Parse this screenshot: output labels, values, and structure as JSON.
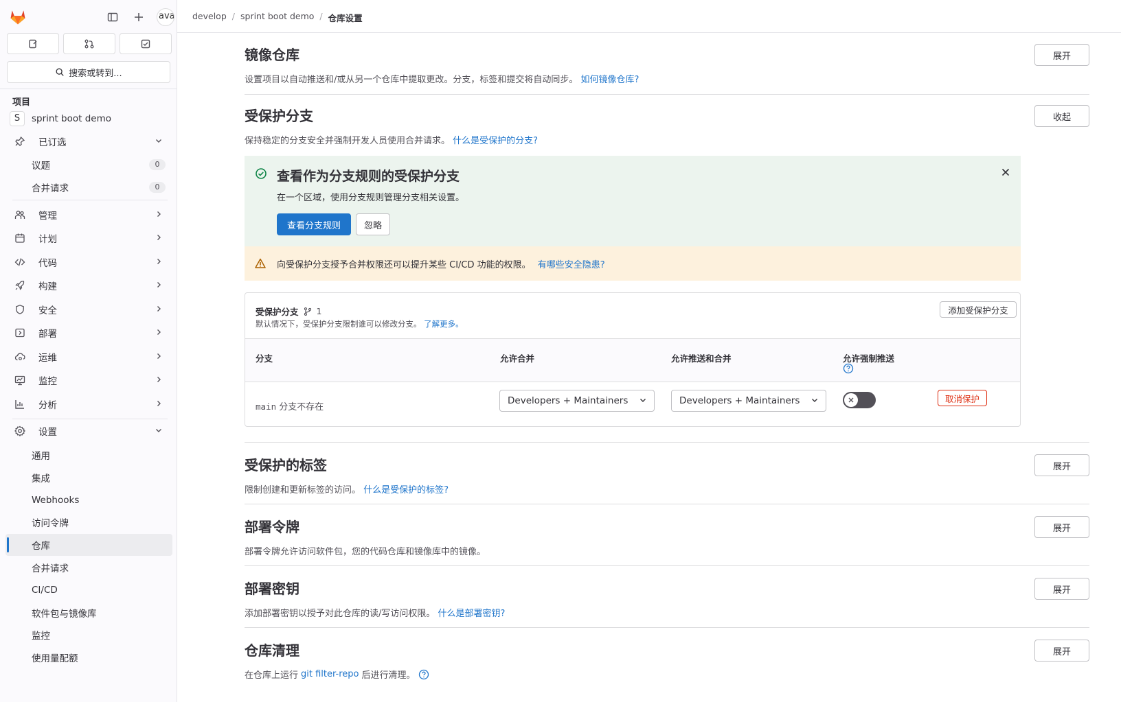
{
  "header": {
    "breadcrumb": [
      "develop",
      "sprint boot demo",
      "仓库设置"
    ],
    "avatar_text": "ava"
  },
  "sidebar": {
    "search_label": "搜索或转到...",
    "section_title": "项目",
    "project_name": "sprint boot demo",
    "project_initial": "S",
    "pinned_label": "已订选",
    "pinned_items": [
      {
        "label": "议题",
        "count": "0"
      },
      {
        "label": "合并请求",
        "count": "0"
      }
    ],
    "nav_items": [
      {
        "label": "管理",
        "icon": "users-icon"
      },
      {
        "label": "计划",
        "icon": "calendar-icon"
      },
      {
        "label": "代码",
        "icon": "code-icon"
      },
      {
        "label": "构建",
        "icon": "rocket-icon"
      },
      {
        "label": "安全",
        "icon": "shield-icon"
      },
      {
        "label": "部署",
        "icon": "deploy-icon"
      },
      {
        "label": "运维",
        "icon": "cloud-gear-icon"
      },
      {
        "label": "监控",
        "icon": "monitor-icon"
      },
      {
        "label": "分析",
        "icon": "chart-icon"
      }
    ],
    "settings_label": "设置",
    "settings_items": [
      "通用",
      "集成",
      "Webhooks",
      "访问令牌",
      "仓库",
      "合并请求",
      "CI/CD",
      "软件包与镜像库",
      "监控",
      "使用量配额"
    ],
    "active_settings_item": "仓库"
  },
  "main": {
    "mirror": {
      "title": "镜像仓库",
      "desc": "设置项目以自动推送和/或从另一个仓库中提取更改。分支，标签和提交将自动同步。",
      "link": "如何镜像仓库?",
      "button": "展开"
    },
    "protected_branches": {
      "title": "受保护分支",
      "desc": "保持稳定的分支安全并强制开发人员使用合并请求。",
      "link": "什么是受保护的分支?",
      "button": "收起",
      "alert": {
        "title": "查看作为分支规则的受保护分支",
        "body": "在一个区域，使用分支规则管理分支相关设置。",
        "primary_button": "查看分支规则",
        "dismiss_button": "忽略"
      },
      "warning": {
        "text": "向受保护分支授予合并权限还可以提升某些 CI/CD 功能的权限。",
        "link": "有哪些安全隐患?"
      },
      "card": {
        "title": "受保护分支",
        "count": "1",
        "subtitle": "默认情况下，受保护分支限制谁可以修改分支。",
        "subtitle_link": "了解更多。",
        "add_button": "添加受保护分支",
        "columns": [
          "分支",
          "允许合并",
          "允许推送和合并",
          "允许强制推送"
        ],
        "row": {
          "branch": "main",
          "branch_note": "分支不存在",
          "allowed_to_merge": "Developers + Maintainers",
          "allowed_to_push": "Developers + Maintainers",
          "force_push": false,
          "unprotect_button": "取消保护"
        }
      }
    },
    "protected_tags": {
      "title": "受保护的标签",
      "desc": "限制创建和更新标签的访问。",
      "link": "什么是受保护的标签?",
      "button": "展开"
    },
    "deploy_tokens": {
      "title": "部署令牌",
      "desc": "部署令牌允许访问软件包，您的代码仓库和镜像库中的镜像。",
      "button": "展开"
    },
    "deploy_keys": {
      "title": "部署密钥",
      "desc": "添加部署密钥以授予对此仓库的读/写访问权限。",
      "link": "什么是部署密钥?",
      "button": "展开"
    },
    "cleanup": {
      "title": "仓库清理",
      "desc_prefix": "在仓库上运行",
      "desc_link": "git filter-repo",
      "desc_suffix": "后进行清理。",
      "button": "展开"
    }
  },
  "colors": {
    "accent": "#1f75cb",
    "primary_button": "#1f75cb",
    "success_bg": "#ecf4ee",
    "warning_bg": "#fdf1dd",
    "danger": "#dd2b0e"
  }
}
